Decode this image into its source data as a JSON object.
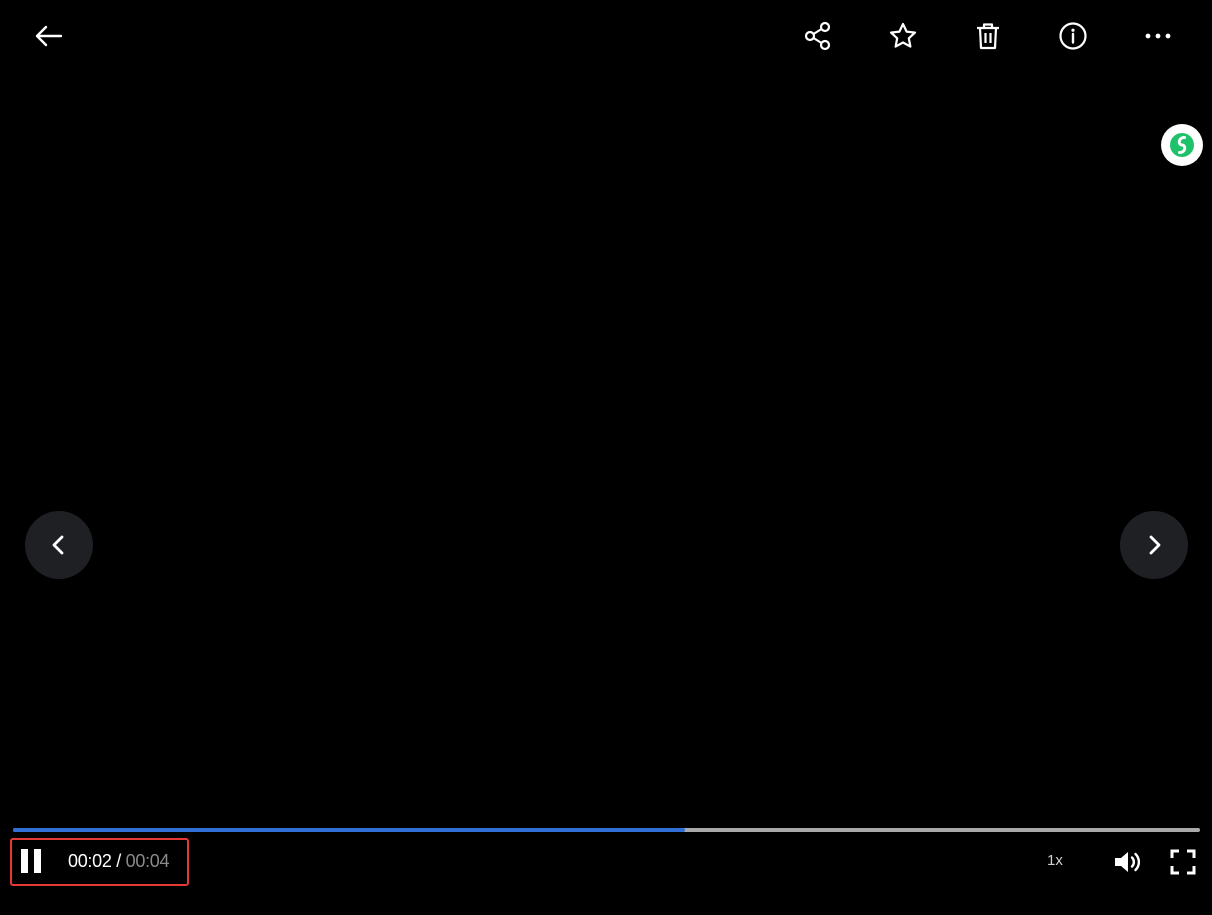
{
  "player": {
    "current_time": "00:02",
    "separator": " / ",
    "total_time": "00:04",
    "progress": 0.566,
    "speed": "1x"
  },
  "icons": {
    "back": "arrow-left-icon",
    "share": "share-icon",
    "favorite": "star-icon",
    "delete": "trash-icon",
    "info": "info-icon",
    "more": "more-horizontal-icon",
    "previous": "chevron-left-icon",
    "next": "chevron-right-icon",
    "play_pause": "pause-icon",
    "volume": "volume-icon",
    "fullscreen": "fullscreen-icon",
    "assistant": "assistant-badge-icon"
  },
  "colors": {
    "background": "#000000",
    "progress_played": "#2f6fd6",
    "progress_track": "#a9a9a9",
    "highlight": "#e53935",
    "nav_button": "#1f2023",
    "assistant_green": "#1ec26a"
  }
}
